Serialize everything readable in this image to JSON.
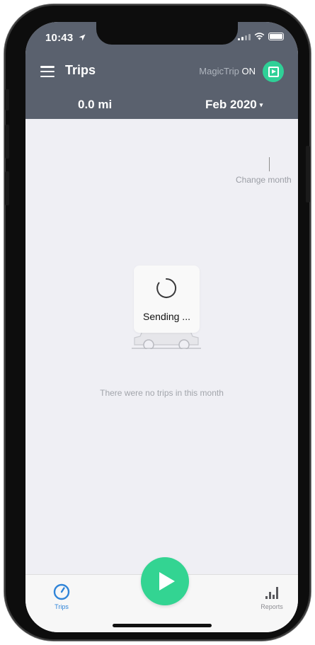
{
  "status_bar": {
    "time": "10:43",
    "location_icon": "location-arrow-icon"
  },
  "header": {
    "title": "Trips",
    "magictrip_label": "MagicTrip",
    "magictrip_state": "ON",
    "distance": "0.0 mi",
    "month": "Feb 2020",
    "month_caret": "▾"
  },
  "main": {
    "change_month_label": "Change month",
    "empty_message": "There were no trips in this month"
  },
  "hud": {
    "text": "Sending ..."
  },
  "tabbar": {
    "tabs": [
      {
        "label": "Trips",
        "icon": "speedometer-icon",
        "active": true
      },
      {
        "label": "Reports",
        "icon": "bar-chart-icon",
        "active": false
      }
    ],
    "play_button_icon": "play-icon"
  },
  "colors": {
    "header_bg": "#5a616e",
    "accent_green": "#33d492",
    "active_blue": "#2f84d8",
    "background": "#efeff4"
  }
}
